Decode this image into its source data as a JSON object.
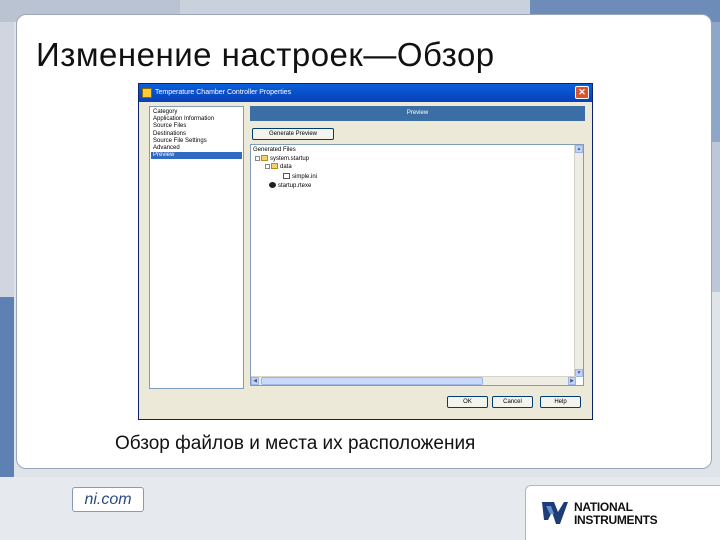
{
  "slide": {
    "title": "Изменение настроек—Обзор",
    "caption": "Обзор файлов и места их расположения"
  },
  "dialog": {
    "title": "Temperature Chamber Controller Properties",
    "close_glyph": "✕",
    "category_header": "Category",
    "categories": [
      {
        "label": "Application Information"
      },
      {
        "label": "Source Files"
      },
      {
        "label": "Destinations"
      },
      {
        "label": "Source File Settings"
      },
      {
        "label": "Advanced"
      },
      {
        "label": "Preview",
        "selected": true
      }
    ],
    "preview_header": "Preview",
    "generate_button": "Generate Preview",
    "files_header": "Generated Files",
    "tree": [
      {
        "label": "system.startup",
        "icon": "folder-icon",
        "expander": "-"
      },
      {
        "label": "data",
        "icon": "folder-icon",
        "expander": "-"
      },
      {
        "label": "simple.ini",
        "icon": "file-icon",
        "expander": ""
      },
      {
        "label": "startup.rtexe",
        "icon": "config-icon",
        "expander": ""
      }
    ],
    "buttons": {
      "ok": "OK",
      "cancel": "Cancel",
      "help": "Help"
    }
  },
  "footer": {
    "ni_com": "ni.com",
    "brand_line1": "NATIONAL",
    "brand_line2": "INSTRUMENTS",
    "brand_color": "#1d3c78"
  }
}
